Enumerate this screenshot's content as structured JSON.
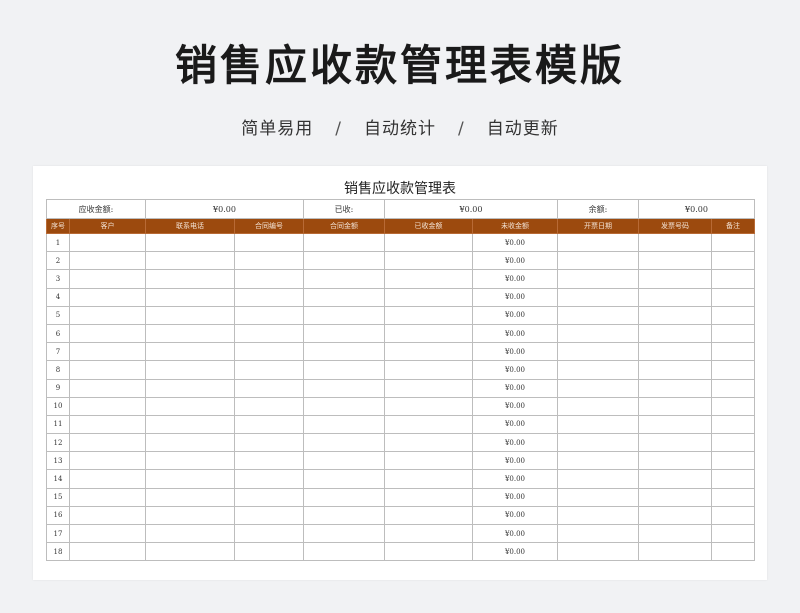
{
  "page": {
    "title": "销售应收款管理表模版",
    "features": [
      "简单易用",
      "自动统计",
      "自动更新"
    ],
    "separator": "/"
  },
  "sheet": {
    "title": "销售应收款管理表",
    "summary": {
      "receivable_label": "应收金额:",
      "receivable_value": "¥0.00",
      "received_label": "已收:",
      "received_value": "¥0.00",
      "balance_label": "余额:",
      "balance_value": "¥0.00"
    },
    "columns": [
      "序号",
      "客户",
      "联系电话",
      "合同编号",
      "合同金额",
      "已收金额",
      "未收金额",
      "开票日期",
      "发票号码",
      "备注"
    ],
    "rows": [
      {
        "no": "1",
        "unpaid": "¥0.00"
      },
      {
        "no": "2",
        "unpaid": "¥0.00"
      },
      {
        "no": "3",
        "unpaid": "¥0.00"
      },
      {
        "no": "4",
        "unpaid": "¥0.00"
      },
      {
        "no": "5",
        "unpaid": "¥0.00"
      },
      {
        "no": "6",
        "unpaid": "¥0.00"
      },
      {
        "no": "7",
        "unpaid": "¥0.00"
      },
      {
        "no": "8",
        "unpaid": "¥0.00"
      },
      {
        "no": "9",
        "unpaid": "¥0.00"
      },
      {
        "no": "10",
        "unpaid": "¥0.00"
      },
      {
        "no": "11",
        "unpaid": "¥0.00"
      },
      {
        "no": "12",
        "unpaid": "¥0.00"
      },
      {
        "no": "13",
        "unpaid": "¥0.00"
      },
      {
        "no": "14",
        "unpaid": "¥0.00"
      },
      {
        "no": "15",
        "unpaid": "¥0.00"
      },
      {
        "no": "16",
        "unpaid": "¥0.00"
      },
      {
        "no": "17",
        "unpaid": "¥0.00"
      },
      {
        "no": "18",
        "unpaid": "¥0.00"
      }
    ]
  }
}
